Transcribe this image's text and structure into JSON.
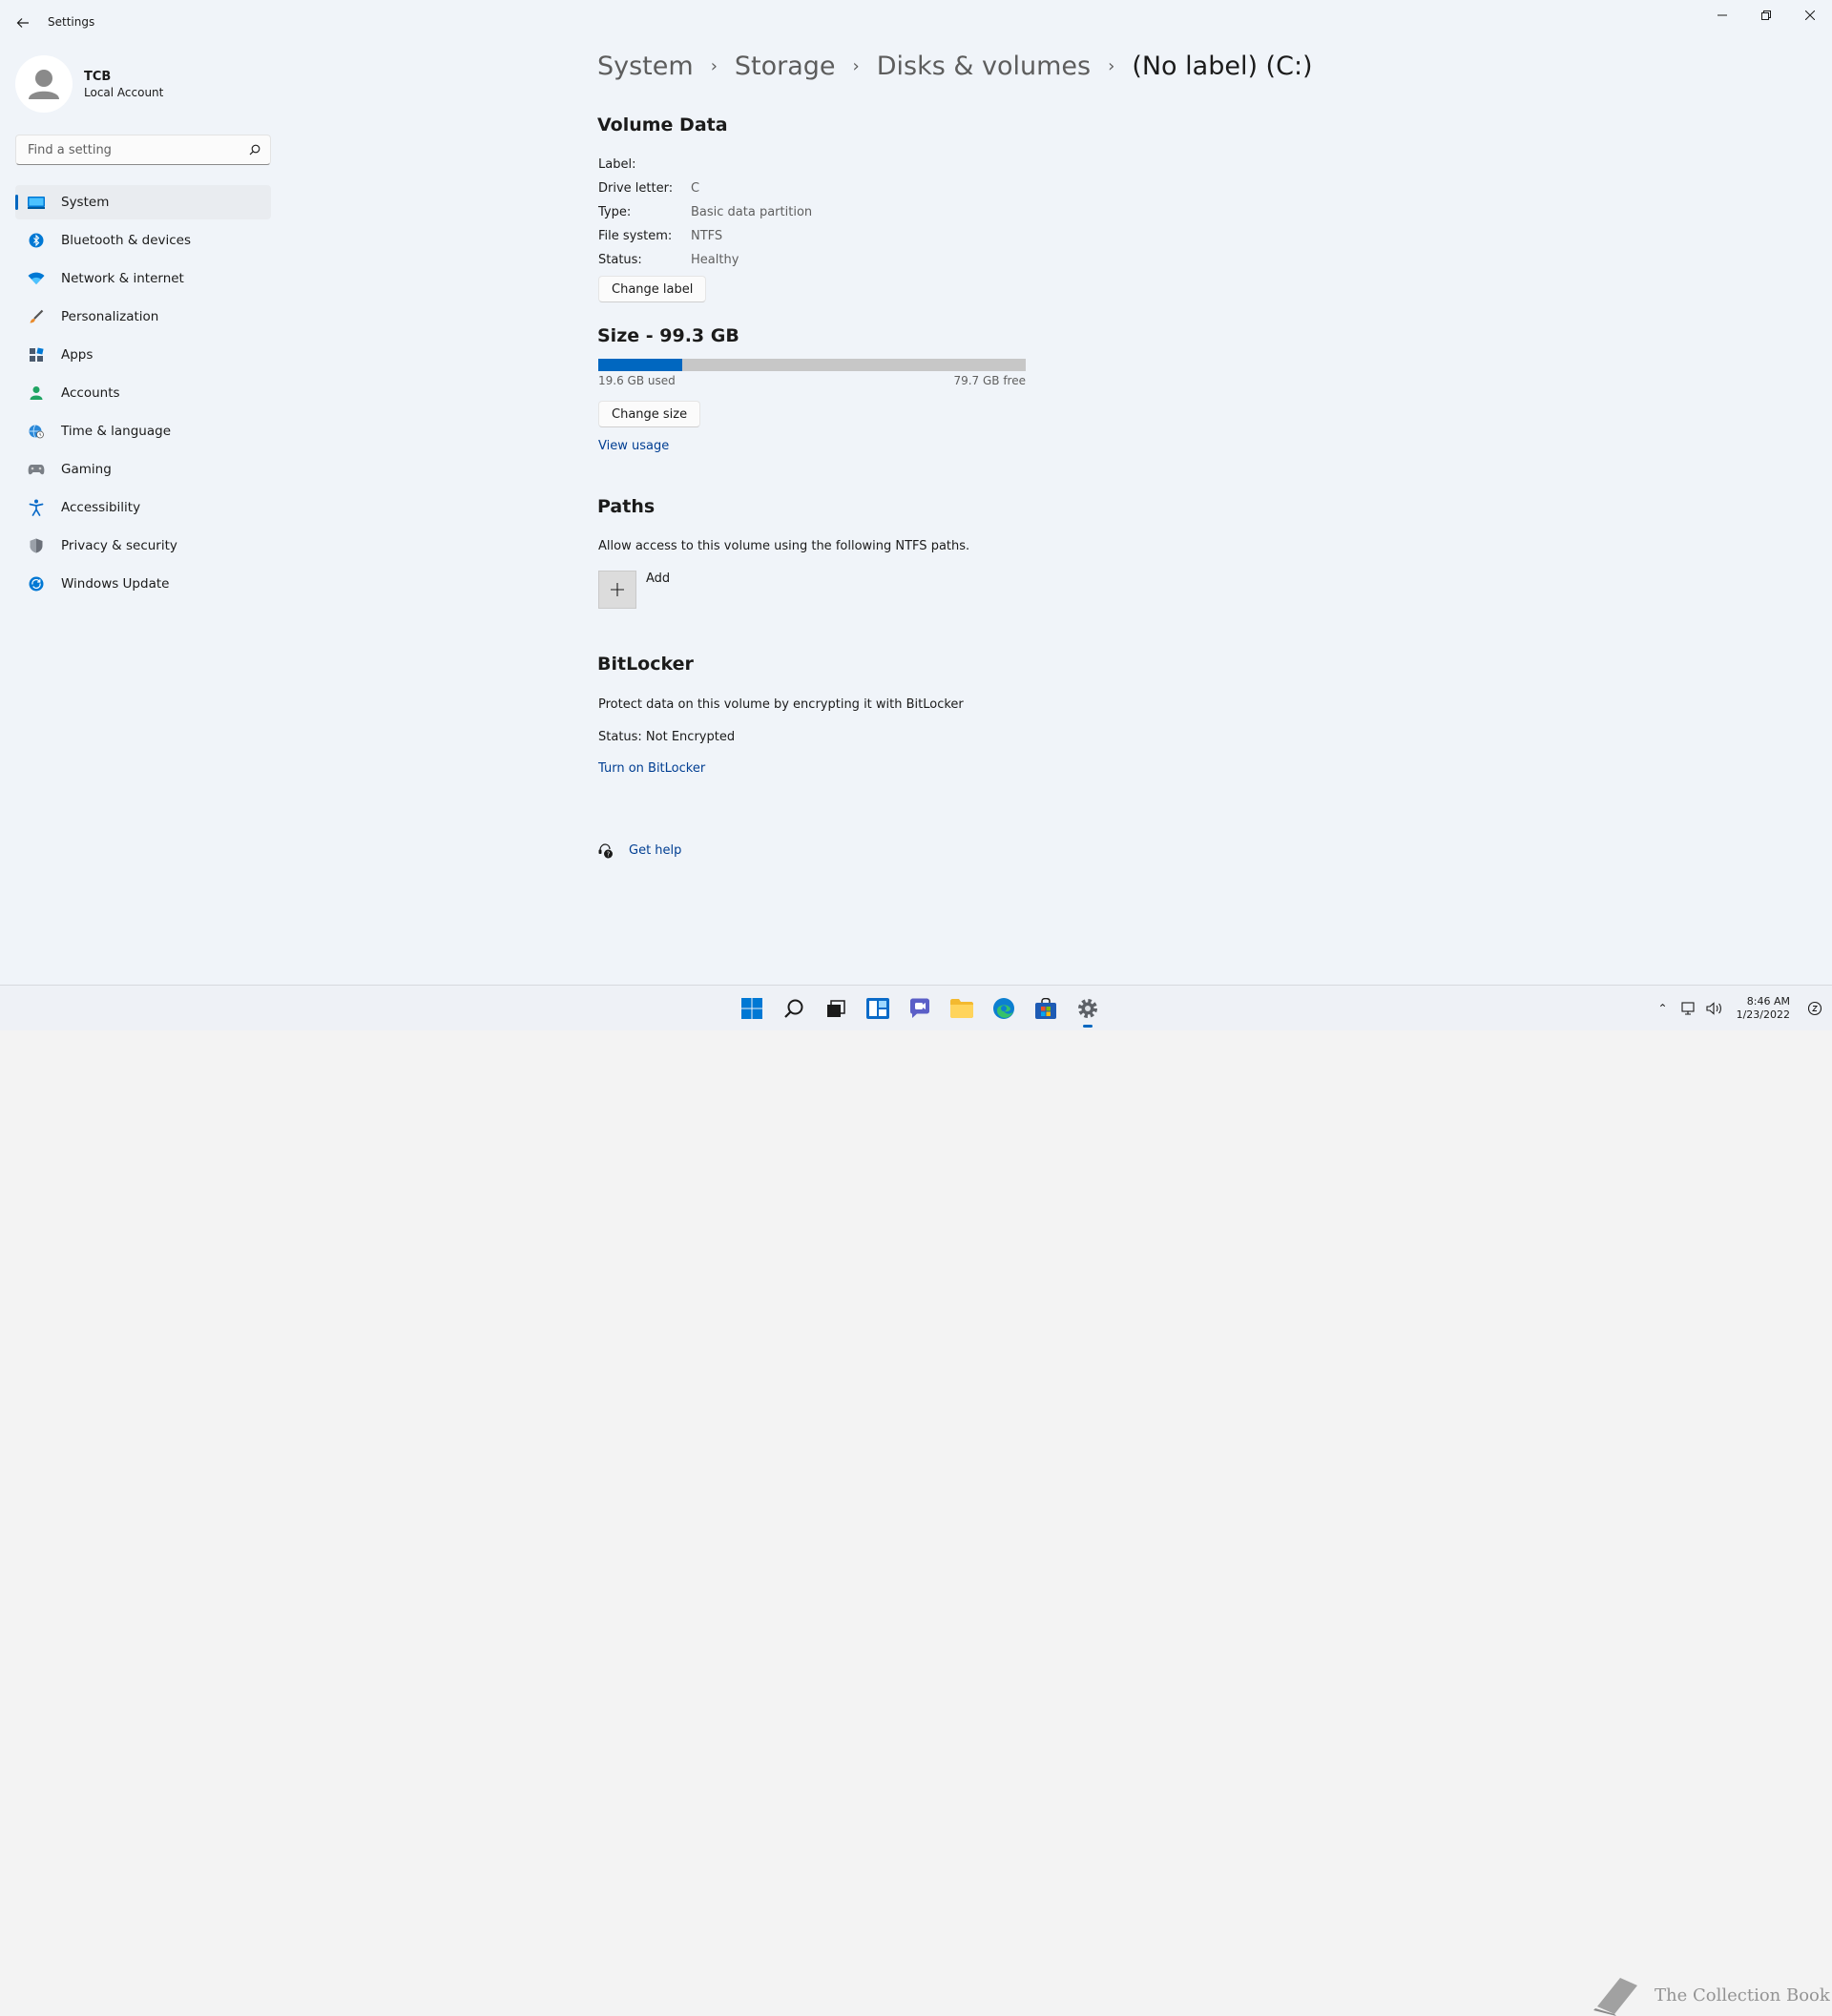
{
  "window": {
    "title": "Settings"
  },
  "profile": {
    "name": "TCB",
    "account_type": "Local Account"
  },
  "search": {
    "placeholder": "Find a setting"
  },
  "nav": {
    "items": [
      {
        "label": "System",
        "icon": "monitor-icon",
        "active": true
      },
      {
        "label": "Bluetooth & devices",
        "icon": "bluetooth-icon"
      },
      {
        "label": "Network & internet",
        "icon": "wifi-icon"
      },
      {
        "label": "Personalization",
        "icon": "brush-icon"
      },
      {
        "label": "Apps",
        "icon": "apps-icon"
      },
      {
        "label": "Accounts",
        "icon": "person-icon"
      },
      {
        "label": "Time & language",
        "icon": "globe-clock-icon"
      },
      {
        "label": "Gaming",
        "icon": "gamepad-icon"
      },
      {
        "label": "Accessibility",
        "icon": "accessibility-icon"
      },
      {
        "label": "Privacy & security",
        "icon": "shield-icon"
      },
      {
        "label": "Windows Update",
        "icon": "update-icon"
      }
    ]
  },
  "breadcrumb": {
    "items": [
      "System",
      "Storage",
      "Disks & volumes"
    ],
    "current": "(No label) (C:)"
  },
  "volume_data": {
    "title": "Volume Data",
    "label_key": "Label:",
    "label_value": "",
    "drive_letter_key": "Drive letter:",
    "drive_letter_value": "C",
    "type_key": "Type:",
    "type_value": "Basic data partition",
    "file_system_key": "File system:",
    "file_system_value": "NTFS",
    "status_key": "Status:",
    "status_value": "Healthy",
    "change_label_button": "Change label"
  },
  "size": {
    "title": "Size - 99.3 GB",
    "used": "19.6 GB used",
    "free": "79.7 GB free",
    "used_fraction": 0.197,
    "change_size_button": "Change size",
    "view_usage_link": "View usage"
  },
  "paths": {
    "title": "Paths",
    "description": "Allow access to this volume using the following NTFS paths.",
    "add_label": "Add"
  },
  "bitlocker": {
    "title": "BitLocker",
    "description": "Protect data on this volume by encrypting it with BitLocker",
    "status": "Status: Not Encrypted",
    "turn_on_link": "Turn on BitLocker"
  },
  "help": {
    "label": "Get help"
  },
  "taskbar": {
    "time": "8:46 AM",
    "date": "1/23/2022",
    "watermark": "The Collection Book"
  },
  "colors": {
    "accent": "#0067c0",
    "link": "#003e92",
    "background": "#f0f4f9"
  }
}
